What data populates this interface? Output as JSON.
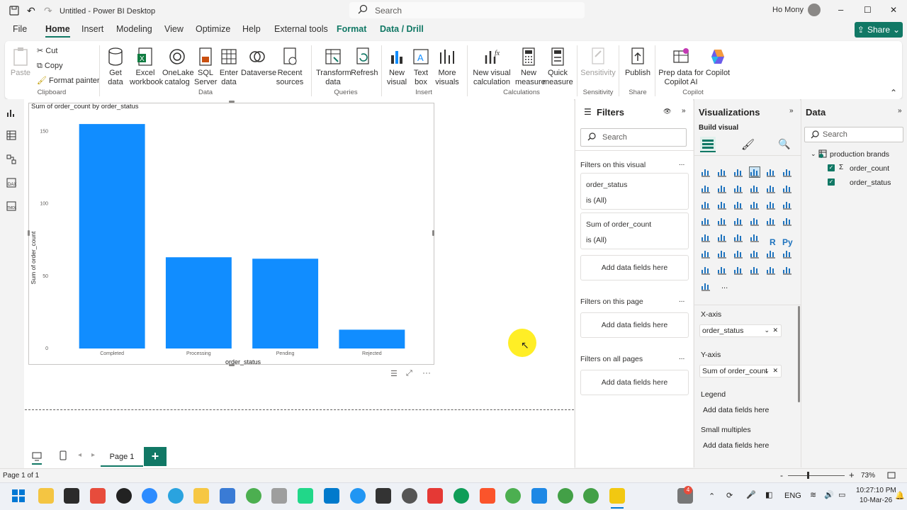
{
  "window": {
    "title": "Untitled - Power BI Desktop",
    "search_placeholder": "Search",
    "user": "Ho Mony",
    "minimize": "–",
    "maximize": "☐",
    "close": "✕"
  },
  "menu": {
    "items": [
      "File",
      "Home",
      "Insert",
      "Modeling",
      "View",
      "Optimize",
      "Help",
      "External tools",
      "Format",
      "Data / Drill"
    ],
    "share": "Share"
  },
  "ribbon": {
    "clipboard": {
      "paste": "Paste",
      "cut": "Cut",
      "copy": "Copy",
      "format_painter": "Format painter",
      "group": "Clipboard"
    },
    "data": {
      "get_data": "Get data",
      "excel": "Excel workbook",
      "onelake": "OneLake catalog",
      "sql": "SQL Server",
      "enter": "Enter data",
      "dataverse": "Dataverse",
      "recent": "Recent sources",
      "group": "Data"
    },
    "queries": {
      "transform": "Transform data",
      "refresh": "Refresh",
      "group": "Queries"
    },
    "insert": {
      "new_visual": "New visual",
      "text_box": "Text box",
      "more_visuals": "More visuals",
      "group": "Insert"
    },
    "calculations": {
      "new_visual_calc": "New visual calculation",
      "new_measure": "New measure",
      "quick_measure": "Quick measure",
      "group": "Calculations"
    },
    "sensitivity": {
      "label": "Sensitivity",
      "group": "Sensitivity"
    },
    "share": {
      "publish": "Publish",
      "group": "Share"
    },
    "copilot": {
      "prep": "Prep data for Copilot AI",
      "copilot": "Copilot",
      "group": "Copilot"
    }
  },
  "chart_data": {
    "type": "bar",
    "title": "Sum of order_count by order_status",
    "xlabel": "order_status",
    "ylabel": "Sum of order_count",
    "categories": [
      "Completed",
      "Processing",
      "Pending",
      "Rejected"
    ],
    "values": [
      155,
      63,
      62,
      13
    ],
    "ylim": [
      0,
      157
    ],
    "yticks": [
      0,
      50,
      100,
      150
    ],
    "color": "#118DFF",
    "grid": false
  },
  "pages": {
    "tabs": [
      "Page 1"
    ],
    "add": "+"
  },
  "filters": {
    "title": "Filters",
    "search_placeholder": "Search",
    "on_visual": "Filters on this visual",
    "card1_field": "order_status",
    "card1_value": "is (All)",
    "card2_field": "Sum of order_count",
    "card2_value": "is (All)",
    "add": "Add data fields here",
    "on_page": "Filters on this page",
    "on_all": "Filters on all pages",
    "more": "..."
  },
  "visualizations": {
    "title": "Visualizations",
    "build": "Build visual",
    "xaxis": "X-axis",
    "xaxis_field": "order_status",
    "yaxis": "Y-axis",
    "yaxis_field": "Sum of order_count",
    "legend": "Legend",
    "small_multiples": "Small multiples",
    "add": "Add data fields here",
    "r": "R",
    "py": "Py",
    "more": "..."
  },
  "data_pane": {
    "title": "Data",
    "search_placeholder": "Search",
    "table": "production brands",
    "fields": [
      "order_count",
      "order_status"
    ]
  },
  "status": {
    "page": "Page 1 of 1",
    "zoom": "73%",
    "zoom_minus": "-",
    "zoom_plus": "+"
  },
  "taskbar": {
    "time": "10:27:10 PM",
    "date": "10-Mar-26",
    "lang": "ENG",
    "badge": "4"
  }
}
